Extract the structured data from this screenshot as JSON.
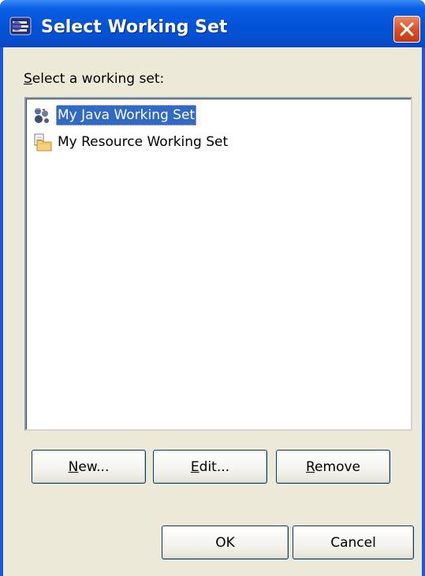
{
  "window": {
    "title": "Select Working Set",
    "title_icon": "eclipse-icon",
    "close_icon": "close-icon"
  },
  "dialog": {
    "list_label": "Select a working set:",
    "working_sets": [
      {
        "label": "My Java Working Set",
        "icon": "java-working-set-icon",
        "selected": true
      },
      {
        "label": "My Resource Working Set",
        "icon": "resource-working-set-icon",
        "selected": false
      }
    ],
    "buttons": {
      "new": "New...",
      "edit": "Edit...",
      "remove": "Remove",
      "ok": "OK",
      "cancel": "Cancel"
    }
  },
  "colors": {
    "title_bar": "#0353d8",
    "selection": "#316ac5",
    "dialog_background": "#ece9d8",
    "close_button": "#d9512a"
  }
}
